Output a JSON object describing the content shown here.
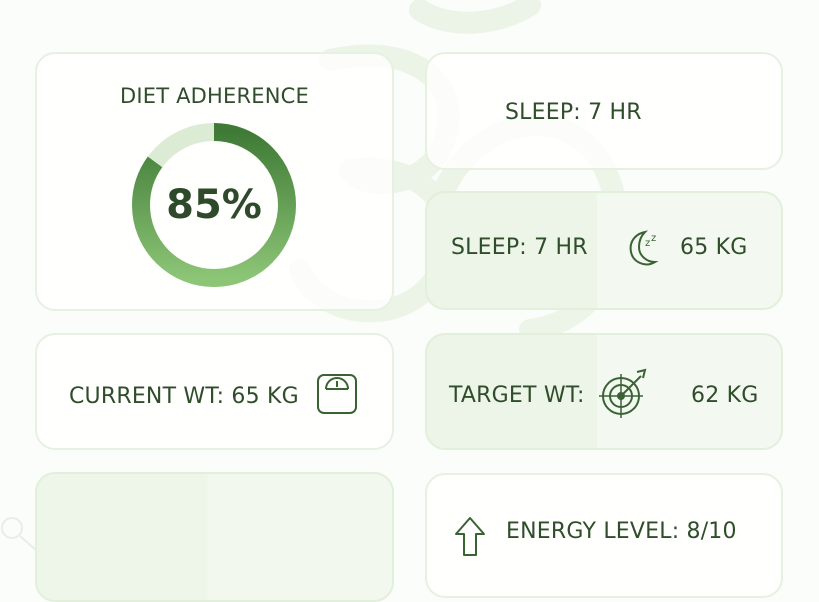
{
  "adherence": {
    "title": "DIET ADHERENCE",
    "value_text": "85%",
    "fraction": 0.85
  },
  "sleep_primary": {
    "label": "SLEEP: 7 HR"
  },
  "sleep_secondary": {
    "label": "SLEEP: 7 HR",
    "weight": "65 KG",
    "icon": "moon-sleep-icon"
  },
  "current_weight": {
    "label": "CURRENT WT: 65 KG",
    "icon": "scale-icon"
  },
  "target_weight": {
    "label": "TARGET WT:",
    "value": "62 KG",
    "icon": "target-icon"
  },
  "energy": {
    "label": "ENERGY LEVEL: 8/10",
    "icon": "arrow-up-icon"
  },
  "colors": {
    "accent_dark": "#3f7a37",
    "accent_light": "#86c06f",
    "text": "#2e4a2a",
    "card_border": "#e6f1e1"
  }
}
